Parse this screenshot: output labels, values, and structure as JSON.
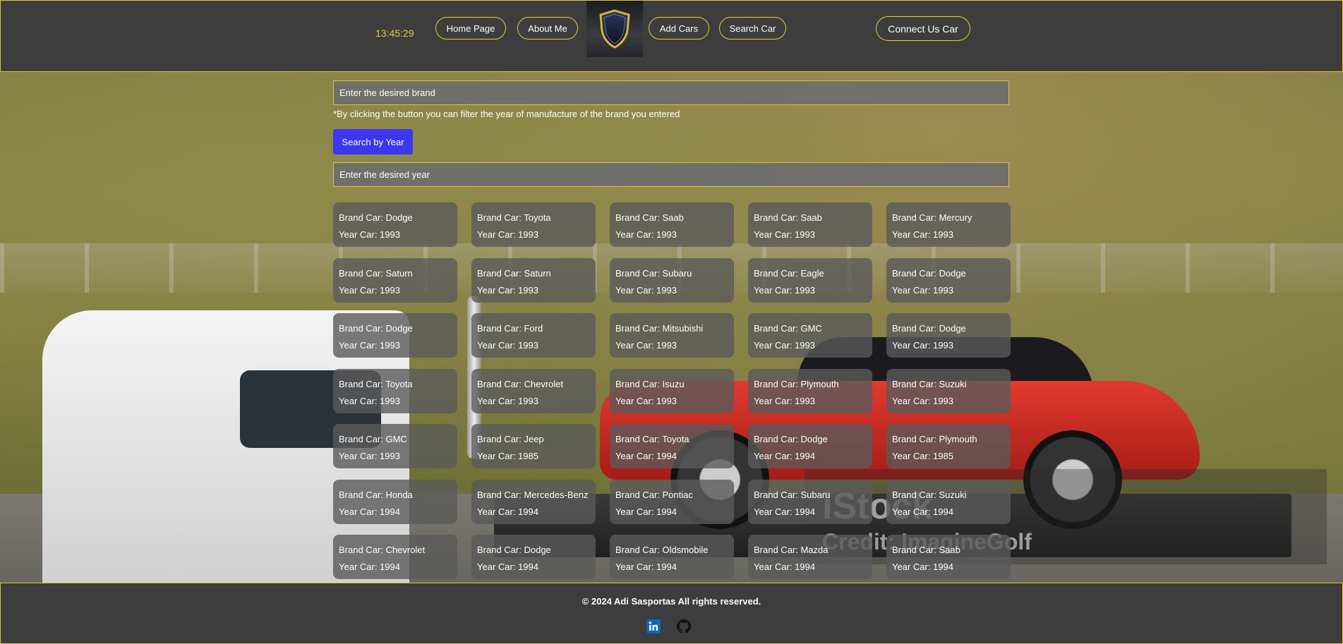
{
  "header": {
    "clock": "13:45:29",
    "nav": [
      "Home Page",
      "About Me",
      "Add Cars",
      "Search Car"
    ],
    "connect_label": "Connect Us Car",
    "accent_color": "#e2cf39"
  },
  "search": {
    "brand_placeholder": "Enter the desired brand",
    "hint": "*By clicking the button you can filter the year of manufacture of the brand you entered",
    "button_label": "Search by Year",
    "year_placeholder": "Enter the desired year",
    "button_color": "#3c36f2"
  },
  "cards": [
    {
      "brand": "Brand Car: Dodge",
      "year": "Year Car: 1993"
    },
    {
      "brand": "Brand Car: Toyota",
      "year": "Year Car: 1993"
    },
    {
      "brand": "Brand Car: Saab",
      "year": "Year Car: 1993"
    },
    {
      "brand": "Brand Car: Saab",
      "year": "Year Car: 1993"
    },
    {
      "brand": "Brand Car: Mercury",
      "year": "Year Car: 1993"
    },
    {
      "brand": "Brand Car: Saturn",
      "year": "Year Car: 1993"
    },
    {
      "brand": "Brand Car: Saturn",
      "year": "Year Car: 1993"
    },
    {
      "brand": "Brand Car: Subaru",
      "year": "Year Car: 1993"
    },
    {
      "brand": "Brand Car: Eagle",
      "year": "Year Car: 1993"
    },
    {
      "brand": "Brand Car: Dodge",
      "year": "Year Car: 1993"
    },
    {
      "brand": "Brand Car: Dodge",
      "year": "Year Car: 1993"
    },
    {
      "brand": "Brand Car: Ford",
      "year": "Year Car: 1993"
    },
    {
      "brand": "Brand Car: Mitsubishi",
      "year": "Year Car: 1993"
    },
    {
      "brand": "Brand Car: GMC",
      "year": "Year Car: 1993"
    },
    {
      "brand": "Brand Car: Dodge",
      "year": "Year Car: 1993"
    },
    {
      "brand": "Brand Car: Toyota",
      "year": "Year Car: 1993"
    },
    {
      "brand": "Brand Car: Chevrolet",
      "year": "Year Car: 1993"
    },
    {
      "brand": "Brand Car: Isuzu",
      "year": "Year Car: 1993"
    },
    {
      "brand": "Brand Car: Plymouth",
      "year": "Year Car: 1993"
    },
    {
      "brand": "Brand Car: Suzuki",
      "year": "Year Car: 1993"
    },
    {
      "brand": "Brand Car: GMC",
      "year": "Year Car: 1993"
    },
    {
      "brand": "Brand Car: Jeep",
      "year": "Year Car: 1985"
    },
    {
      "brand": "Brand Car: Toyota",
      "year": "Year Car: 1994"
    },
    {
      "brand": "Brand Car: Dodge",
      "year": "Year Car: 1994"
    },
    {
      "brand": "Brand Car: Plymouth",
      "year": "Year Car: 1985"
    },
    {
      "brand": "Brand Car: Honda",
      "year": "Year Car: 1994"
    },
    {
      "brand": "Brand Car: Mercedes-Benz",
      "year": "Year Car: 1994"
    },
    {
      "brand": "Brand Car: Pontiac",
      "year": "Year Car: 1994"
    },
    {
      "brand": "Brand Car: Subaru",
      "year": "Year Car: 1994"
    },
    {
      "brand": "Brand Car: Suzuki",
      "year": "Year Car: 1994"
    },
    {
      "brand": "Brand Car: Chevrolet",
      "year": "Year Car: 1994"
    },
    {
      "brand": "Brand Car: Dodge",
      "year": "Year Car: 1994"
    },
    {
      "brand": "Brand Car: Oldsmobile",
      "year": "Year Car: 1994"
    },
    {
      "brand": "Brand Car: Mazda",
      "year": "Year Car: 1994"
    },
    {
      "brand": "Brand Car: Saab",
      "year": "Year Car: 1994"
    }
  ],
  "background": {
    "watermark_line1": "iStock",
    "watermark_line2": "Credit: ImagineGolf"
  },
  "footer": {
    "copyright": "© 2024 Adi Sasportas All rights reserved.",
    "icons": [
      "linkedin-icon",
      "github-icon"
    ]
  }
}
